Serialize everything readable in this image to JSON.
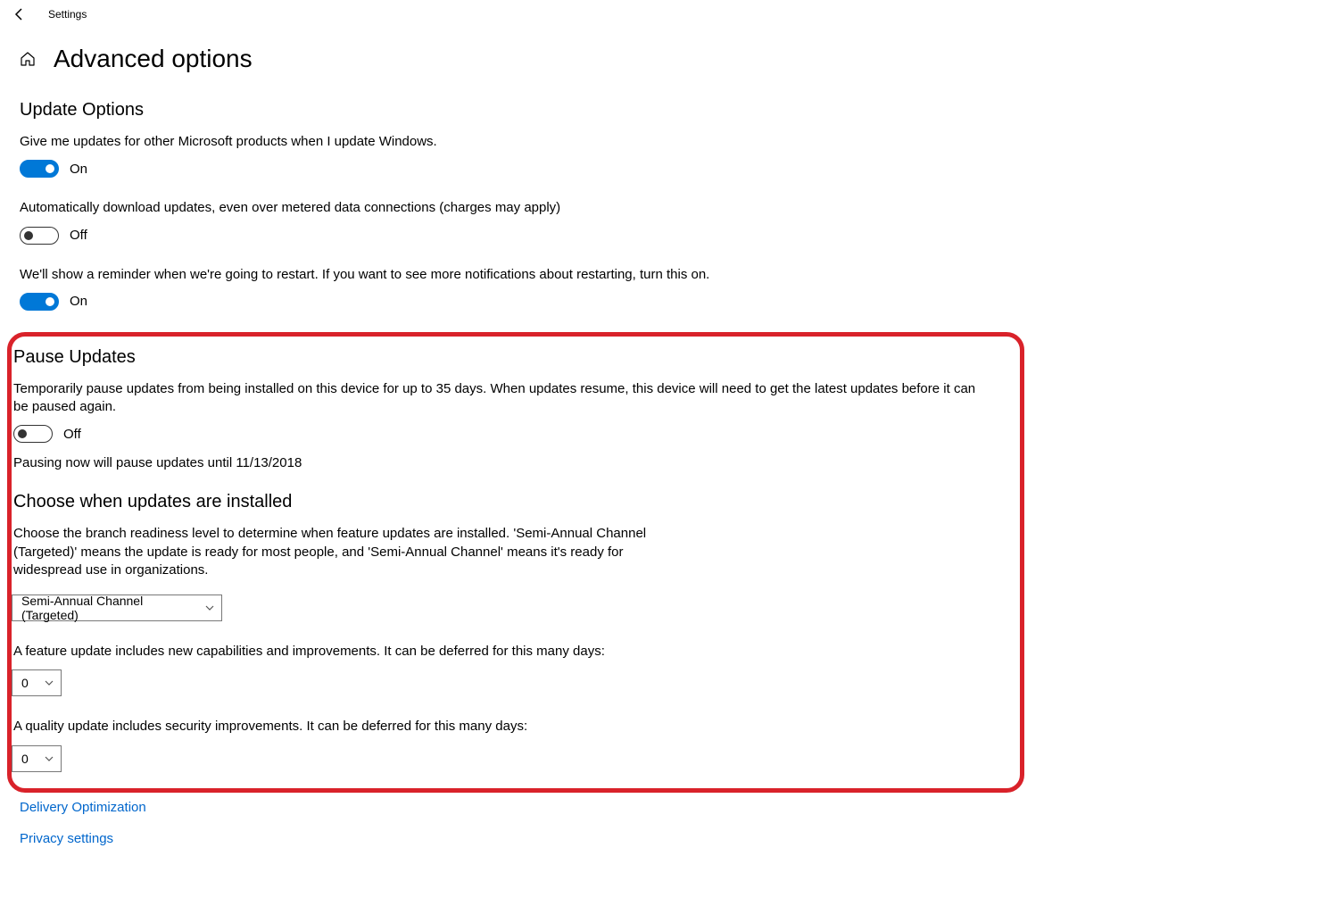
{
  "titlebar": {
    "app_name": "Settings"
  },
  "page": {
    "title": "Advanced options"
  },
  "sections": {
    "update_options": {
      "title": "Update Options",
      "other_products": {
        "desc": "Give me updates for other Microsoft products when I update Windows.",
        "state_label": "On"
      },
      "metered": {
        "desc": "Automatically download updates, even over metered data connections (charges may apply)",
        "state_label": "Off"
      },
      "restart_reminder": {
        "desc": "We'll show a reminder when we're going to restart. If you want to see more notifications about restarting, turn this on.",
        "state_label": "On"
      }
    },
    "pause_updates": {
      "title": "Pause Updates",
      "desc": "Temporarily pause updates from being installed on this device for up to 35 days. When updates resume, this device will need to get the latest updates before it can be paused again.",
      "state_label": "Off",
      "pause_until_note": "Pausing now will pause updates until 11/13/2018"
    },
    "choose_when": {
      "title": "Choose when updates are installed",
      "branch_desc": "Choose the branch readiness level to determine when feature updates are installed. 'Semi-Annual Channel (Targeted)' means the update is ready for most people, and 'Semi-Annual Channel' means it's ready for widespread use in organizations.",
      "branch_value": "Semi-Annual Channel (Targeted)",
      "feature_defer_desc": "A feature update includes new capabilities and improvements. It can be deferred for this many days:",
      "feature_defer_value": "0",
      "quality_defer_desc": "A quality update includes security improvements. It can be deferred for this many days:",
      "quality_defer_value": "0"
    }
  },
  "links": {
    "delivery_optimization": "Delivery Optimization",
    "privacy_settings": "Privacy settings"
  }
}
